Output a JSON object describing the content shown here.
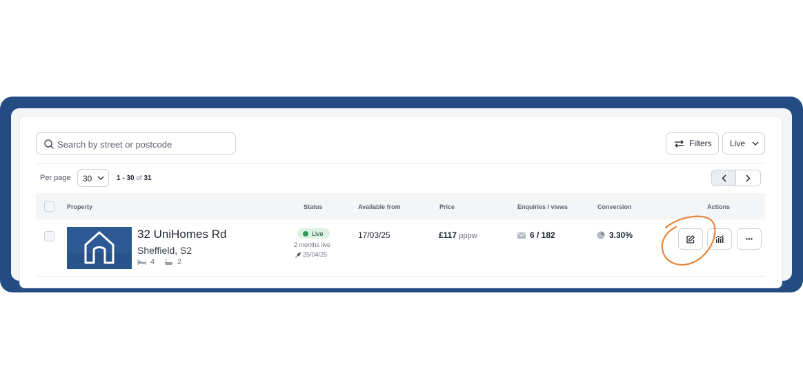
{
  "search": {
    "placeholder": "Search by street or postcode"
  },
  "toolbar": {
    "filters_label": "Filters",
    "status_filter_value": "Live"
  },
  "pagination": {
    "per_page_label": "Per page",
    "per_page_value": "30",
    "range_start": "1",
    "range_end": "30",
    "range_of": "of",
    "total": "31"
  },
  "table": {
    "columns": [
      "Property",
      "Status",
      "Available from",
      "Price",
      "Enquiries / views",
      "Conversion",
      "Actions"
    ],
    "rows": [
      {
        "title": "32 UniHomes Rd",
        "city": "Sheffield, S2",
        "bedrooms": "4",
        "bathrooms": "2",
        "status": "Live",
        "status_duration": "2 months live",
        "status_date": "25/04/25",
        "available_from": "17/03/25",
        "price": "£117",
        "price_unit": "pppw",
        "enquiries_views": "6 / 182",
        "conversion": "3.30%"
      }
    ]
  },
  "colors": {
    "frame": "#234d82",
    "live_badge": "#dcf3e4",
    "live_dot": "#2e9d5b",
    "annotation": "#e8843a"
  }
}
